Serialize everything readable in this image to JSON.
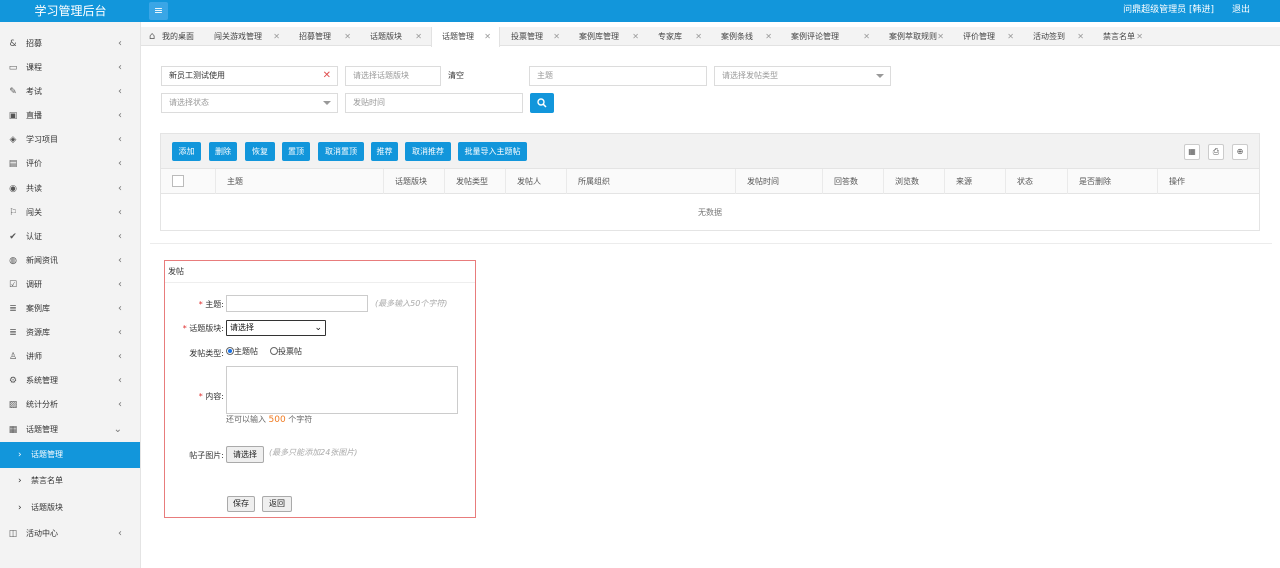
{
  "app": {
    "title": "学习管理后台",
    "user": "问鼎超级管理员 [韩进]",
    "logout": "退出"
  },
  "sidebar": {
    "items": [
      {
        "label": "招募",
        "icon": "ampersand-icon",
        "glyph": "&"
      },
      {
        "label": "课程",
        "icon": "book-icon",
        "glyph": "▭"
      },
      {
        "label": "考试",
        "icon": "edit-icon",
        "glyph": "✎"
      },
      {
        "label": "直播",
        "icon": "video-icon",
        "glyph": "▣"
      },
      {
        "label": "学习项目",
        "icon": "cube-icon",
        "glyph": "◈"
      },
      {
        "label": "评价",
        "icon": "chat-icon",
        "glyph": "▤"
      },
      {
        "label": "共读",
        "icon": "eye-icon",
        "glyph": "◉"
      },
      {
        "label": "闯关",
        "icon": "flag-icon",
        "glyph": "⚐"
      },
      {
        "label": "认证",
        "icon": "check-circle-icon",
        "glyph": "✔"
      },
      {
        "label": "新闻资讯",
        "icon": "globe-icon",
        "glyph": "◍"
      },
      {
        "label": "调研",
        "icon": "survey-icon",
        "glyph": "☑"
      },
      {
        "label": "案例库",
        "icon": "database-icon",
        "glyph": "≣"
      },
      {
        "label": "资源库",
        "icon": "database-icon",
        "glyph": "≣"
      },
      {
        "label": "讲师",
        "icon": "user-icon",
        "glyph": "♙"
      },
      {
        "label": "系统管理",
        "icon": "gear-icon",
        "glyph": "⚙"
      },
      {
        "label": "统计分析",
        "icon": "image-icon",
        "glyph": "▨"
      },
      {
        "label": "话题管理",
        "icon": "topic-icon",
        "glyph": "▦"
      }
    ],
    "sub": [
      {
        "label": "话题管理",
        "active": true
      },
      {
        "label": "禁言名单",
        "active": false
      },
      {
        "label": "话题版块",
        "active": false
      }
    ],
    "last": {
      "label": "活动中心",
      "icon": "activity-icon",
      "glyph": "◫"
    }
  },
  "tabs": [
    {
      "label": "我的桌面",
      "home": true
    },
    {
      "label": "闯关游戏管理"
    },
    {
      "label": "招募管理"
    },
    {
      "label": "话题版块"
    },
    {
      "label": "话题管理",
      "active": true
    },
    {
      "label": "投票管理"
    },
    {
      "label": "案例库管理"
    },
    {
      "label": "专家库"
    },
    {
      "label": "案例条线"
    },
    {
      "label": "案例评论管理"
    },
    {
      "label": "案例萃取规则"
    },
    {
      "label": "评价管理"
    },
    {
      "label": "活动签到"
    },
    {
      "label": "禁言名单"
    }
  ],
  "filters": {
    "org": "新员工测试使用",
    "board_placeholder": "请选择话题版块",
    "clear": "清空",
    "topic_placeholder": "主题",
    "type_placeholder": "请选择发帖类型",
    "status_placeholder": "请选择状态",
    "time_placeholder": "发贴时间"
  },
  "toolbar": [
    "添加",
    "删除",
    "恢复",
    "置顶",
    "取消置顶",
    "推荐",
    "取消推荐",
    "批量导入主题帖"
  ],
  "table": {
    "columns": [
      "主题",
      "话题版块",
      "发帖类型",
      "发帖人",
      "所属组织",
      "发帖时间",
      "回答数",
      "浏览数",
      "来源",
      "状态",
      "是否删除",
      "操作"
    ],
    "empty": "无数据"
  },
  "form": {
    "title": "发帖",
    "subject_label": "主题:",
    "subject_hint": "(最多输入50个字符)",
    "board_label": "话题版块:",
    "board_value": "请选择",
    "type_label": "发帖类型:",
    "type_option1": "主题帖",
    "type_option2": "投票帖",
    "content_label": "内容:",
    "remain_prefix": "还可以输入",
    "remain_count": "500",
    "remain_suffix": "个字符",
    "image_label": "帖子图片:",
    "choose": "请选择",
    "image_hint": "(最多只能添加24张图片)",
    "save": "保存",
    "back": "返回"
  }
}
